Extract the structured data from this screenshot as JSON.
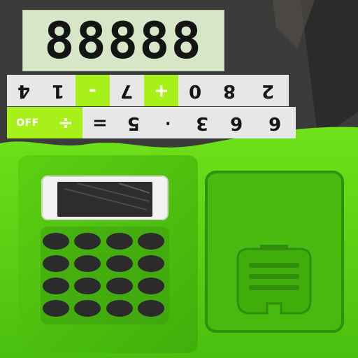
{
  "display": {
    "value": "88888"
  },
  "keypad": {
    "row1": [
      "4",
      "1",
      "-",
      "7",
      "+",
      "0",
      "8",
      "2"
    ],
    "row2": [
      "OFF",
      "÷",
      "=",
      "5",
      "·",
      "3",
      "6",
      "6"
    ]
  },
  "colors": {
    "lcd_bg": "#d7e6c7",
    "key_bg": "#e7e7e7",
    "accent_green": "#a7f01a",
    "body_green": "#5fcf16"
  },
  "icons": {
    "solar_panel": "solar-panel-icon",
    "battery_cover": "battery-cover-icon"
  }
}
